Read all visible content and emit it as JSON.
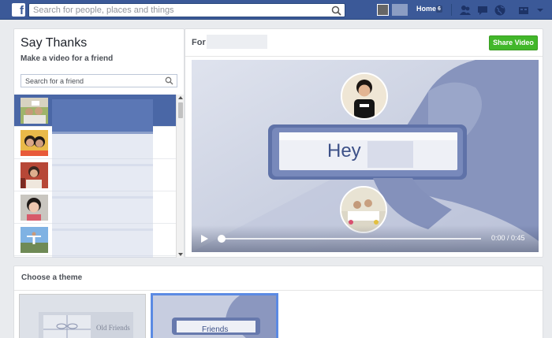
{
  "topbar": {
    "search_placeholder": "Search for people, places and things",
    "home_label": "Home",
    "home_count": "6",
    "brand_color": "#3b5998"
  },
  "say_thanks": {
    "title": "Say Thanks",
    "subtitle": "Make a video for a friend",
    "search_placeholder": "Search for a friend"
  },
  "friends": [
    {
      "selected": true
    },
    {
      "selected": false
    },
    {
      "selected": false
    },
    {
      "selected": false
    },
    {
      "selected": false
    }
  ],
  "editor": {
    "for_label": "For",
    "share_label": "Share Video",
    "share_color": "#42b72a"
  },
  "video": {
    "greeting": "Hey",
    "time": "0:00 / 0:45",
    "progress": 0.0
  },
  "themes": {
    "title": "Choose a theme",
    "items": [
      {
        "label": "Old Friends",
        "selected": false
      },
      {
        "label": "Friends",
        "selected": true
      }
    ]
  }
}
